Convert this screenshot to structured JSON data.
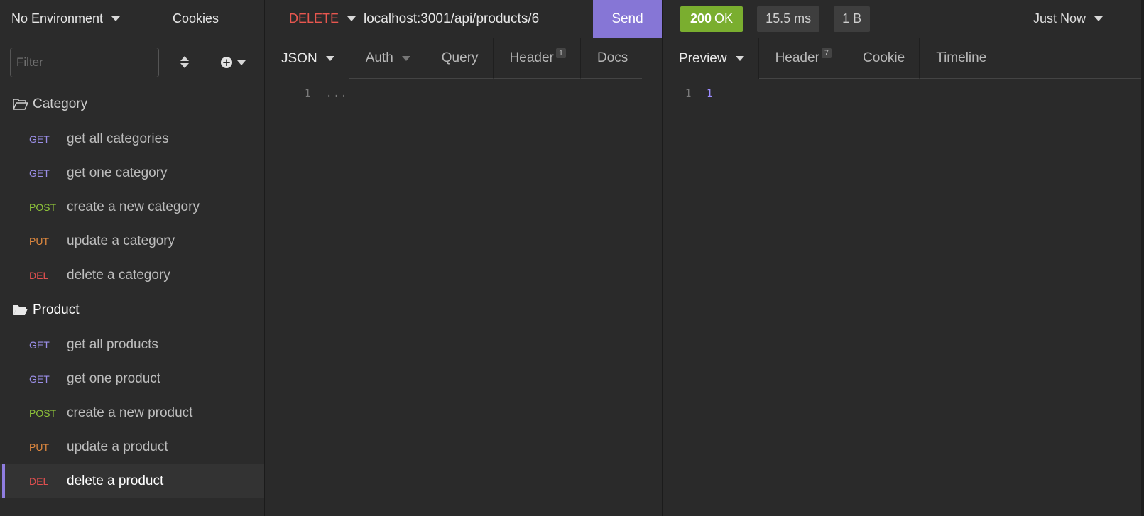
{
  "sidebar": {
    "environment": "No Environment",
    "cookies": "Cookies",
    "filter_placeholder": "Filter",
    "folders": [
      {
        "name": "Category",
        "requests": [
          {
            "method": "GET",
            "name": "get all categories",
            "color": "#9b8fe8"
          },
          {
            "method": "GET",
            "name": "get one category",
            "color": "#9b8fe8"
          },
          {
            "method": "POST",
            "name": "create a new category",
            "color": "#8fc43a"
          },
          {
            "method": "PUT",
            "name": "update a category",
            "color": "#e0893f"
          },
          {
            "method": "DEL",
            "name": "delete a category",
            "color": "#e04f4f"
          }
        ]
      },
      {
        "name": "Product",
        "requests": [
          {
            "method": "GET",
            "name": "get all products",
            "color": "#9b8fe8"
          },
          {
            "method": "GET",
            "name": "get one product",
            "color": "#9b8fe8"
          },
          {
            "method": "POST",
            "name": "create a new product",
            "color": "#8fc43a"
          },
          {
            "method": "PUT",
            "name": "update a product",
            "color": "#e0893f"
          },
          {
            "method": "DEL",
            "name": "delete a product",
            "color": "#e04f4f",
            "active": true
          }
        ]
      }
    ]
  },
  "request": {
    "method": "DELETE",
    "method_color": "#e8574f",
    "url": "localhost:3001/api/products/6",
    "send_label": "Send",
    "tabs": {
      "body": "JSON",
      "auth": "Auth",
      "query": "Query",
      "header": "Header",
      "header_count": "1",
      "docs": "Docs"
    },
    "body": {
      "line_number": "1",
      "content": "..."
    }
  },
  "response": {
    "status_code": "200",
    "status_text": "OK",
    "time": "15.5 ms",
    "size": "1 B",
    "history": "Just Now",
    "tabs": {
      "preview": "Preview",
      "header": "Header",
      "header_count": "7",
      "cookie": "Cookie",
      "timeline": "Timeline"
    },
    "body": {
      "line_number": "1",
      "content": "1"
    }
  },
  "colors": {
    "accent": "#8676d6",
    "status_ok": "#7aae2f"
  }
}
